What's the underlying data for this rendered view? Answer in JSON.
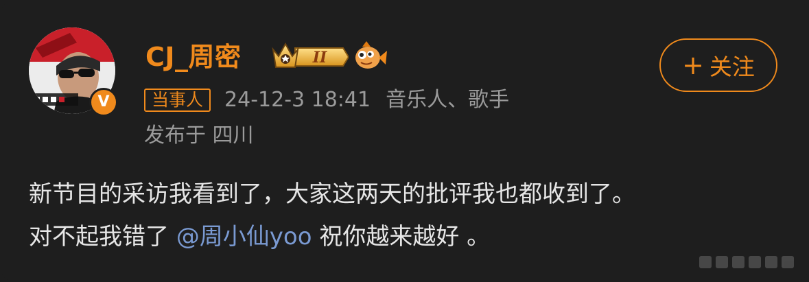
{
  "post": {
    "author": {
      "name": "CJ_周密",
      "verified_icon": "verified-v-icon",
      "badge_rank_icon": "crown-rank-II-icon",
      "badge_fan_icon": "fish-fan-icon",
      "badge_rank_text": "II",
      "verified_letter": "V"
    },
    "tag": "当事人",
    "timestamp": "24-12-3 18:41",
    "author_desc": "音乐人、歌手",
    "location": "发布于 四川",
    "follow_button": {
      "icon": "plus-icon",
      "plus": "+",
      "label": "关注"
    },
    "content": {
      "line1": "新节目的采访我看到了，大家这两天的批评我也都收到了。",
      "line2_prefix": "对不起我错了 ",
      "mention": "@周小仙yoo",
      "line2_suffix": " 祝你越来越好 。"
    }
  },
  "colors": {
    "background": "#1e1e1e",
    "accent": "#f08a1c",
    "mention": "#7a9ad2",
    "body_text": "#e6e6e6",
    "meta_text": "#9b9b9b"
  }
}
